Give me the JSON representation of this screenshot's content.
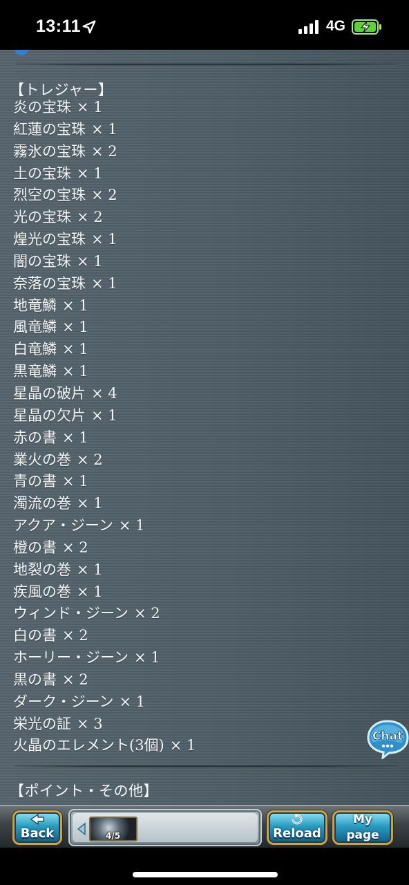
{
  "status_bar": {
    "time": "13:11",
    "network": "4G",
    "icons": [
      "location-arrow-icon",
      "signal-bars-icon",
      "battery-charging-icon"
    ]
  },
  "content": {
    "treasure_header": "【トレジャー】",
    "items": [
      {
        "name": "炎の宝珠",
        "qty": "× 1"
      },
      {
        "name": "紅蓮の宝珠",
        "qty": "× 1"
      },
      {
        "name": "霧氷の宝珠",
        "qty": "× 2"
      },
      {
        "name": "土の宝珠",
        "qty": "× 1"
      },
      {
        "name": "烈空の宝珠",
        "qty": "× 2"
      },
      {
        "name": "光の宝珠",
        "qty": "× 2"
      },
      {
        "name": "煌光の宝珠",
        "qty": "× 1"
      },
      {
        "name": "闇の宝珠",
        "qty": "× 1"
      },
      {
        "name": "奈落の宝珠",
        "qty": "× 1"
      },
      {
        "name": "地竜鱗",
        "qty": "× 1"
      },
      {
        "name": "風竜鱗",
        "qty": "× 1"
      },
      {
        "name": "白竜鱗",
        "qty": "× 1"
      },
      {
        "name": "黒竜鱗",
        "qty": "× 1"
      },
      {
        "name": "星晶の破片",
        "qty": "× 4"
      },
      {
        "name": "星晶の欠片",
        "qty": "× 1"
      },
      {
        "name": "赤の書",
        "qty": "× 1"
      },
      {
        "name": "業火の巻",
        "qty": "× 2"
      },
      {
        "name": "青の書",
        "qty": "× 1"
      },
      {
        "name": "濁流の巻",
        "qty": "× 1"
      },
      {
        "name": "アクア・ジーン",
        "qty": "× 1"
      },
      {
        "name": "橙の書",
        "qty": "× 2"
      },
      {
        "name": "地裂の巻",
        "qty": "× 1"
      },
      {
        "name": "疾風の巻",
        "qty": "× 1"
      },
      {
        "name": "ウィンド・ジーン",
        "qty": "× 2"
      },
      {
        "name": "白の書",
        "qty": "× 2"
      },
      {
        "name": "ホーリー・ジーン",
        "qty": "× 1"
      },
      {
        "name": "黒の書",
        "qty": "× 2"
      },
      {
        "name": "ダーク・ジーン",
        "qty": "× 1"
      },
      {
        "name": "栄光の証",
        "qty": "× 3"
      },
      {
        "name": "火晶のエレメント(3個)",
        "qty": "× 1"
      }
    ],
    "points_header": "【ポイント・その他】"
  },
  "chat_button": {
    "label": "Chat"
  },
  "bottom_nav": {
    "back_label": "Back",
    "reload_label": "Reload",
    "mypage_label_top": "My",
    "mypage_label_bottom": "page",
    "party_count": "4/5"
  }
}
